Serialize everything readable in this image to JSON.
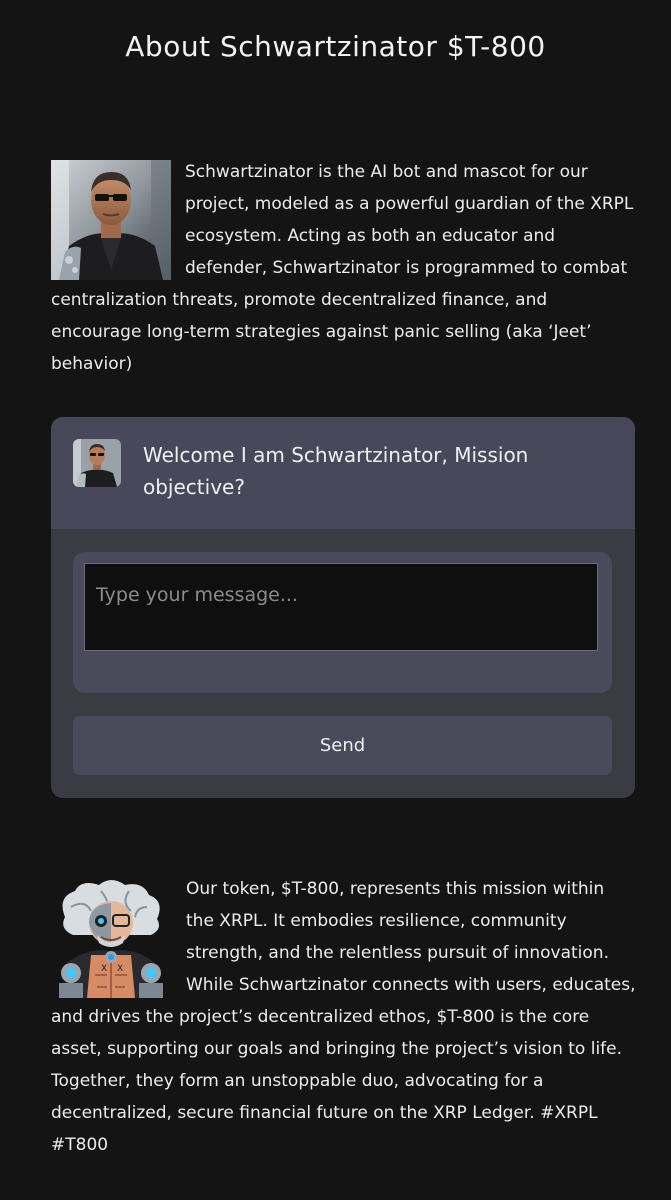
{
  "page": {
    "title": "About Schwartzinator $T-800"
  },
  "about": {
    "text": "Schwartzinator is the AI bot and mascot for our project, modeled as a powerful guardian of the XRPL ecosystem. Acting as both an educator and defender, Schwartzinator is programmed to combat centralization threats, promote decentralized finance, and encourage long-term strategies against panic selling (aka ‘Jeet’ behavior)"
  },
  "chat": {
    "welcome": "Welcome I am Schwartzinator, Mission objective?",
    "placeholder": "Type your message...",
    "send_label": "Send"
  },
  "token": {
    "text": "Our token, $T-800, represents this mission within the XRPL. It embodies resilience, community strength, and the relentless pursuit of innovation. While Schwartzinator connects with users, educates, and drives the project’s decentralized ethos, $T-800 is the core asset, supporting our goals and bringing the project’s vision to life. Together, they form an unstoppable duo, advocating for a decentralized, secure financial future on the XRP Ledger. #XRPL #T800"
  },
  "colors": {
    "background": "#141414",
    "chat_panel": "#3b3b43",
    "chat_header": "#48485a",
    "input_bg": "#0f0f0f"
  }
}
